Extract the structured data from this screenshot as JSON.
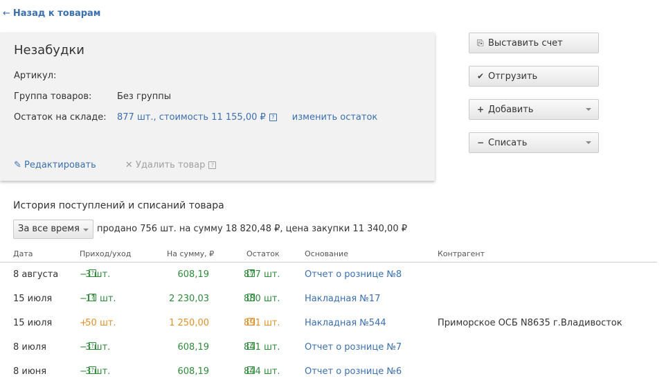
{
  "nav": {
    "back_label": "Назад к товарам",
    "back_arrow": "←"
  },
  "product": {
    "name": "Незабудки",
    "article_label": "Артикул:",
    "article_value": "",
    "group_label": "Группа товаров:",
    "group_value": "Без группы",
    "stock_label": "Остаток на складе:",
    "stock_value": "877 шт., стоимость 11 155,00 ₽",
    "stock_help": "?",
    "change_stock_label": "изменить остаток",
    "edit_label": "Редактировать",
    "delete_label": "Удалить товар",
    "delete_help": "?"
  },
  "actions": {
    "invoice": "Выставить счет",
    "ship": "Отгрузить",
    "add": "Добавить",
    "writeoff": "Списать"
  },
  "history": {
    "title": "История поступлений и списаний товара",
    "period": "За все время",
    "summary": "продано 756 шт. на сумму 18 820,48 ₽, цена закупки 11 340,00 ₽",
    "columns": {
      "date": "Дата",
      "move": "Приход/уход",
      "sum": "На сумму, ₽",
      "rest": "Остаток",
      "base": "Основание",
      "party": "Контрагент"
    },
    "rows": [
      {
        "date": "8 августа",
        "sign": "−",
        "qty": "3 шт.",
        "sum": "608,19",
        "rest": "877 шт.",
        "base": "Отчет о рознице №8",
        "party": "",
        "kind": "out"
      },
      {
        "date": "15 июля",
        "sign": "−",
        "qty": "11 шт.",
        "sum": "2 230,03",
        "rest": "880 шт.",
        "base": "Накладная №17",
        "party": "",
        "kind": "out"
      },
      {
        "date": "15 июля",
        "sign": "+",
        "qty": "50 шт.",
        "sum": "1 250,00",
        "rest": "891 шт.",
        "base": "Накладная №544",
        "party": "Приморское ОСБ N8635 г.Владивосток",
        "kind": "in"
      },
      {
        "date": "8 июля",
        "sign": "−",
        "qty": "3 шт.",
        "sum": "608,19",
        "rest": "841 шт.",
        "base": "Отчет о рознице №7",
        "party": "",
        "kind": "out"
      },
      {
        "date": "8 июня",
        "sign": "−",
        "qty": "3 шт.",
        "sum": "608,19",
        "rest": "844 шт.",
        "base": "Отчет о рознице №6",
        "party": "",
        "kind": "out"
      }
    ]
  },
  "colors": {
    "link": "#3a6fb0",
    "out": "#2e8b3a",
    "in": "#e0902a"
  }
}
